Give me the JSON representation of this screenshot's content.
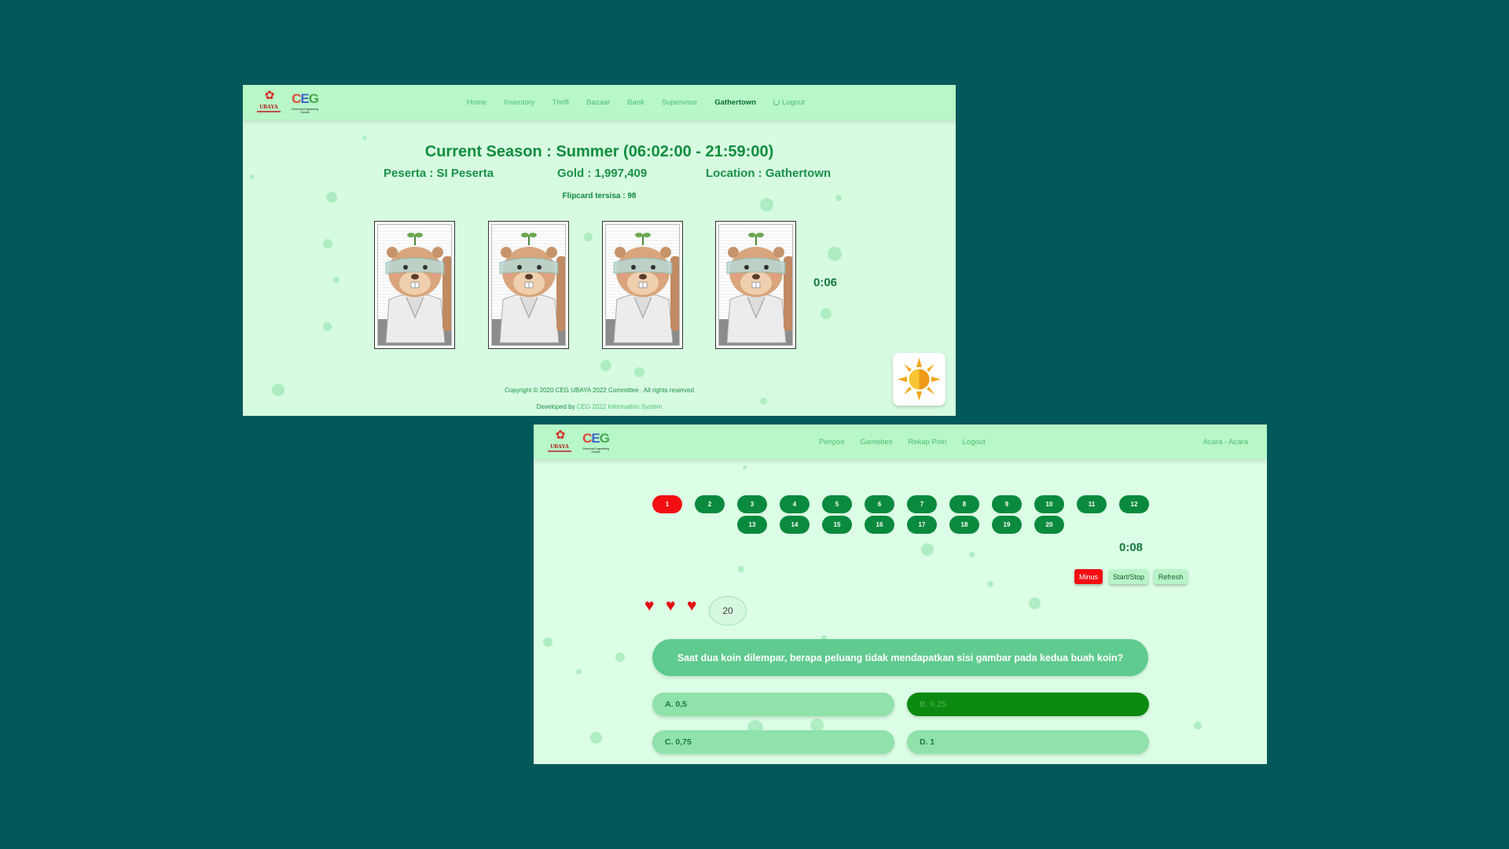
{
  "window1": {
    "logos": {
      "ubaya": "UBAYA",
      "ceg_tagline": "Chemical Engineering Games"
    },
    "nav": {
      "items": [
        {
          "label": "Home",
          "active": false
        },
        {
          "label": "Inventory",
          "active": false
        },
        {
          "label": "Thrift",
          "active": false
        },
        {
          "label": "Bazaar",
          "active": false
        },
        {
          "label": "Bank",
          "active": false
        },
        {
          "label": "Supervisor",
          "active": false
        },
        {
          "label": "Gathertown",
          "active": true
        }
      ],
      "logout": "Logout"
    },
    "season_title": "Current Season : Summer (06:02:00 - 21:59:00)",
    "peserta": "Peserta : SI Peserta",
    "gold": "Gold : 1,997,409",
    "location": "Location : Gathertown",
    "flipcard": "Flipcard tersisa : 98",
    "cards_count": 4,
    "timer": "0:06",
    "season_icon": "sun-icon",
    "footer": {
      "copyright": "Copyright © 2020 CEG UBAYA 2022 Committee . All rights reserved",
      "developed_prefix": "Developed by",
      "developed_link": "CEG 2022 Information System"
    }
  },
  "window2": {
    "nav": {
      "items": [
        "Penpos",
        "Gamebes",
        "Rekap Poin",
        "Logout"
      ],
      "right": "Acara - Acara"
    },
    "questions_row1": [
      "1",
      "2",
      "3",
      "4",
      "5",
      "6",
      "7",
      "8",
      "9",
      "10",
      "11",
      "12"
    ],
    "questions_row2": [
      "13",
      "14",
      "15",
      "16",
      "17",
      "18",
      "19",
      "20"
    ],
    "active_question": "1",
    "timer": "0:08",
    "controls": {
      "minus": "Minus",
      "startstop": "Start/Stop",
      "refresh": "Refresh"
    },
    "lives": 3,
    "score": "20",
    "question": "Saat dua koin dilempar, berapa peluang tidak mendapatkan sisi gambar pada kedua buah koin?",
    "answers": {
      "a": "A. 0,5",
      "b": "B. 0,25",
      "c": "C. 0,75",
      "d": "D. 1"
    },
    "correct_answer": "b",
    "colors": {
      "accent": "#0a8a3e",
      "active": "#f20e12",
      "correct": "#0c8a10"
    }
  },
  "colors": {
    "background": "#03585a",
    "navbar": "#b8f7c7",
    "page": "#d7fbe1"
  }
}
